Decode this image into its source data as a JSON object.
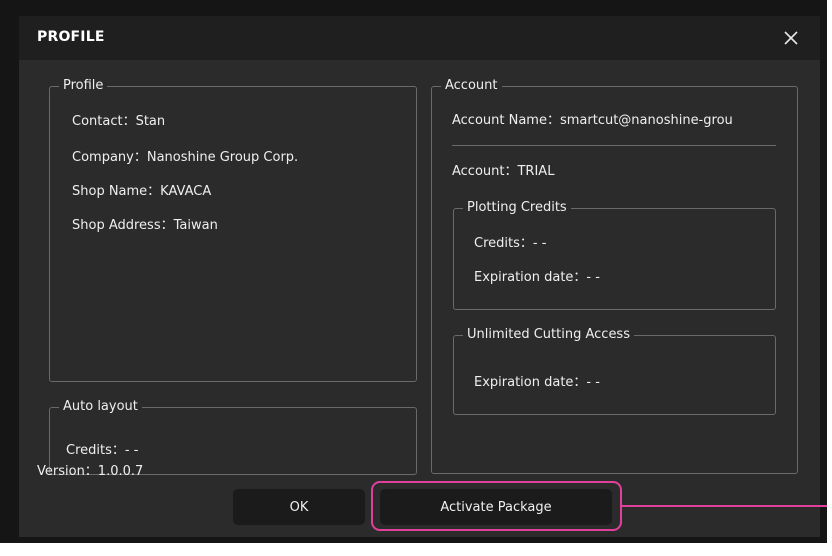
{
  "window": {
    "title": "PROFILE"
  },
  "profile": {
    "legend": "Profile",
    "contact": "Contact：Stan",
    "company": "Company：Nanoshine Group Corp.",
    "shop_name": "Shop Name：KAVACA",
    "shop_address": "Shop Address：Taiwan"
  },
  "auto_layout": {
    "legend": "Auto layout",
    "credits": "Credits：- -"
  },
  "account": {
    "legend": "Account",
    "account_name": "Account Name：smartcut@nanoshine-grou",
    "account_type": "Account：TRIAL",
    "plotting_credits": {
      "legend": "Plotting Credits",
      "credits": "Credits：- -",
      "expiration": "Expiration date：- -"
    },
    "unlimited_cutting": {
      "legend": "Unlimited Cutting Access",
      "expiration": "Expiration date：- -"
    }
  },
  "footer": {
    "version": "Version：1.0.0.7",
    "ok_label": "OK",
    "activate_label": "Activate Package"
  },
  "colors": {
    "dialog_bg": "#2b2b2b",
    "titlebar_bg": "#1f1f1f",
    "highlight": "#e0409c"
  },
  "icons": {
    "close": "close-icon"
  }
}
